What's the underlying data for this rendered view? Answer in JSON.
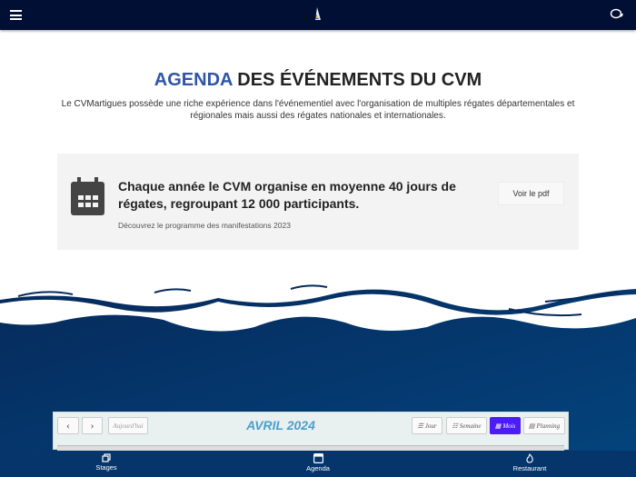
{
  "header": {
    "menu_icon": "hamburger-icon",
    "logo_icon": "sailboat-logo",
    "chat_icon": "chat-bubbles-icon"
  },
  "title": {
    "accent": "AGENDA",
    "rest": " DES ÉVÉNEMENTS DU CVM",
    "accent_color": "#2f55a5"
  },
  "intro": "Le CVMartigues possède une riche expérience dans l'événementiel avec l'organisation de multiples régates départementales et régionales mais aussi des régates nationales et internationales.",
  "card": {
    "title": "Chaque année le CVM organise en moyenne 40 jours de régates, regroupant 12 000 participants.",
    "subtitle": "Découvrez le programme des manifestations 2023",
    "button": "Voir le pdf"
  },
  "calendar": {
    "prev": "‹",
    "next": "›",
    "today": "Aujourd'hui",
    "month": "AVRIL 2024",
    "views": [
      {
        "label": "Jour",
        "active": false
      },
      {
        "label": "Semaine",
        "active": false
      },
      {
        "label": "Mois",
        "active": true
      },
      {
        "label": "Planning",
        "active": false
      }
    ]
  },
  "bottom_nav": [
    {
      "label": "Stages",
      "icon": "copy-icon"
    },
    {
      "label": "Agenda",
      "icon": "calendar-icon"
    },
    {
      "label": "Restaurant",
      "icon": "flame-icon"
    }
  ]
}
